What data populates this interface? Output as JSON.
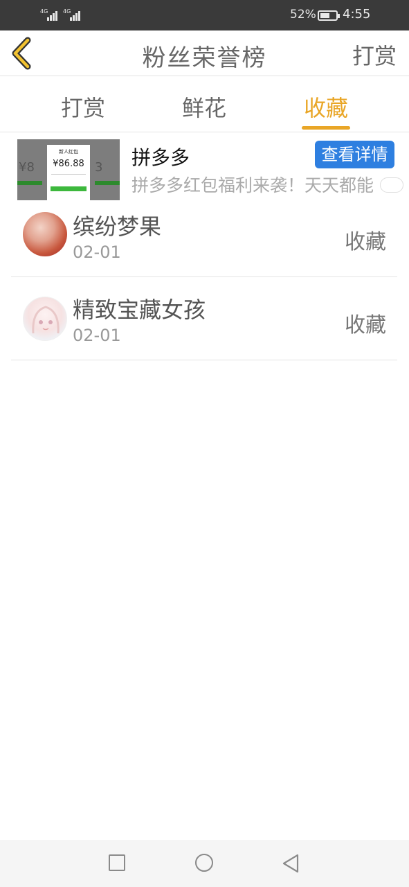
{
  "status_bar": {
    "network_left": "4G",
    "network_right": "4G",
    "battery_percent": "52%",
    "battery_level": 0.52,
    "time": "4:55"
  },
  "header": {
    "back_icon": "chevron-left-icon",
    "title": "粉丝荣誉榜",
    "right_link": "打赏",
    "accent_color": "#e9a627"
  },
  "tabs": [
    {
      "label": "打赏",
      "active": false
    },
    {
      "label": "鲜花",
      "active": false
    },
    {
      "label": "收藏",
      "active": true
    }
  ],
  "ad": {
    "thumbnail": {
      "card_title": "新人红包",
      "amount": "¥86.88"
    },
    "name": "拼多多",
    "detail_button": "查看详情",
    "description": "拼多多红包福利来袭！天天都能",
    "button_color": "#2e7fe0"
  },
  "list": [
    {
      "name": "缤纷梦果",
      "date": "02-01",
      "action": "收藏"
    },
    {
      "name": "精致宝藏女孩",
      "date": "02-01",
      "action": "收藏"
    }
  ],
  "navbar": {
    "icons": [
      "square-icon",
      "circle-icon",
      "triangle-back-icon"
    ]
  }
}
